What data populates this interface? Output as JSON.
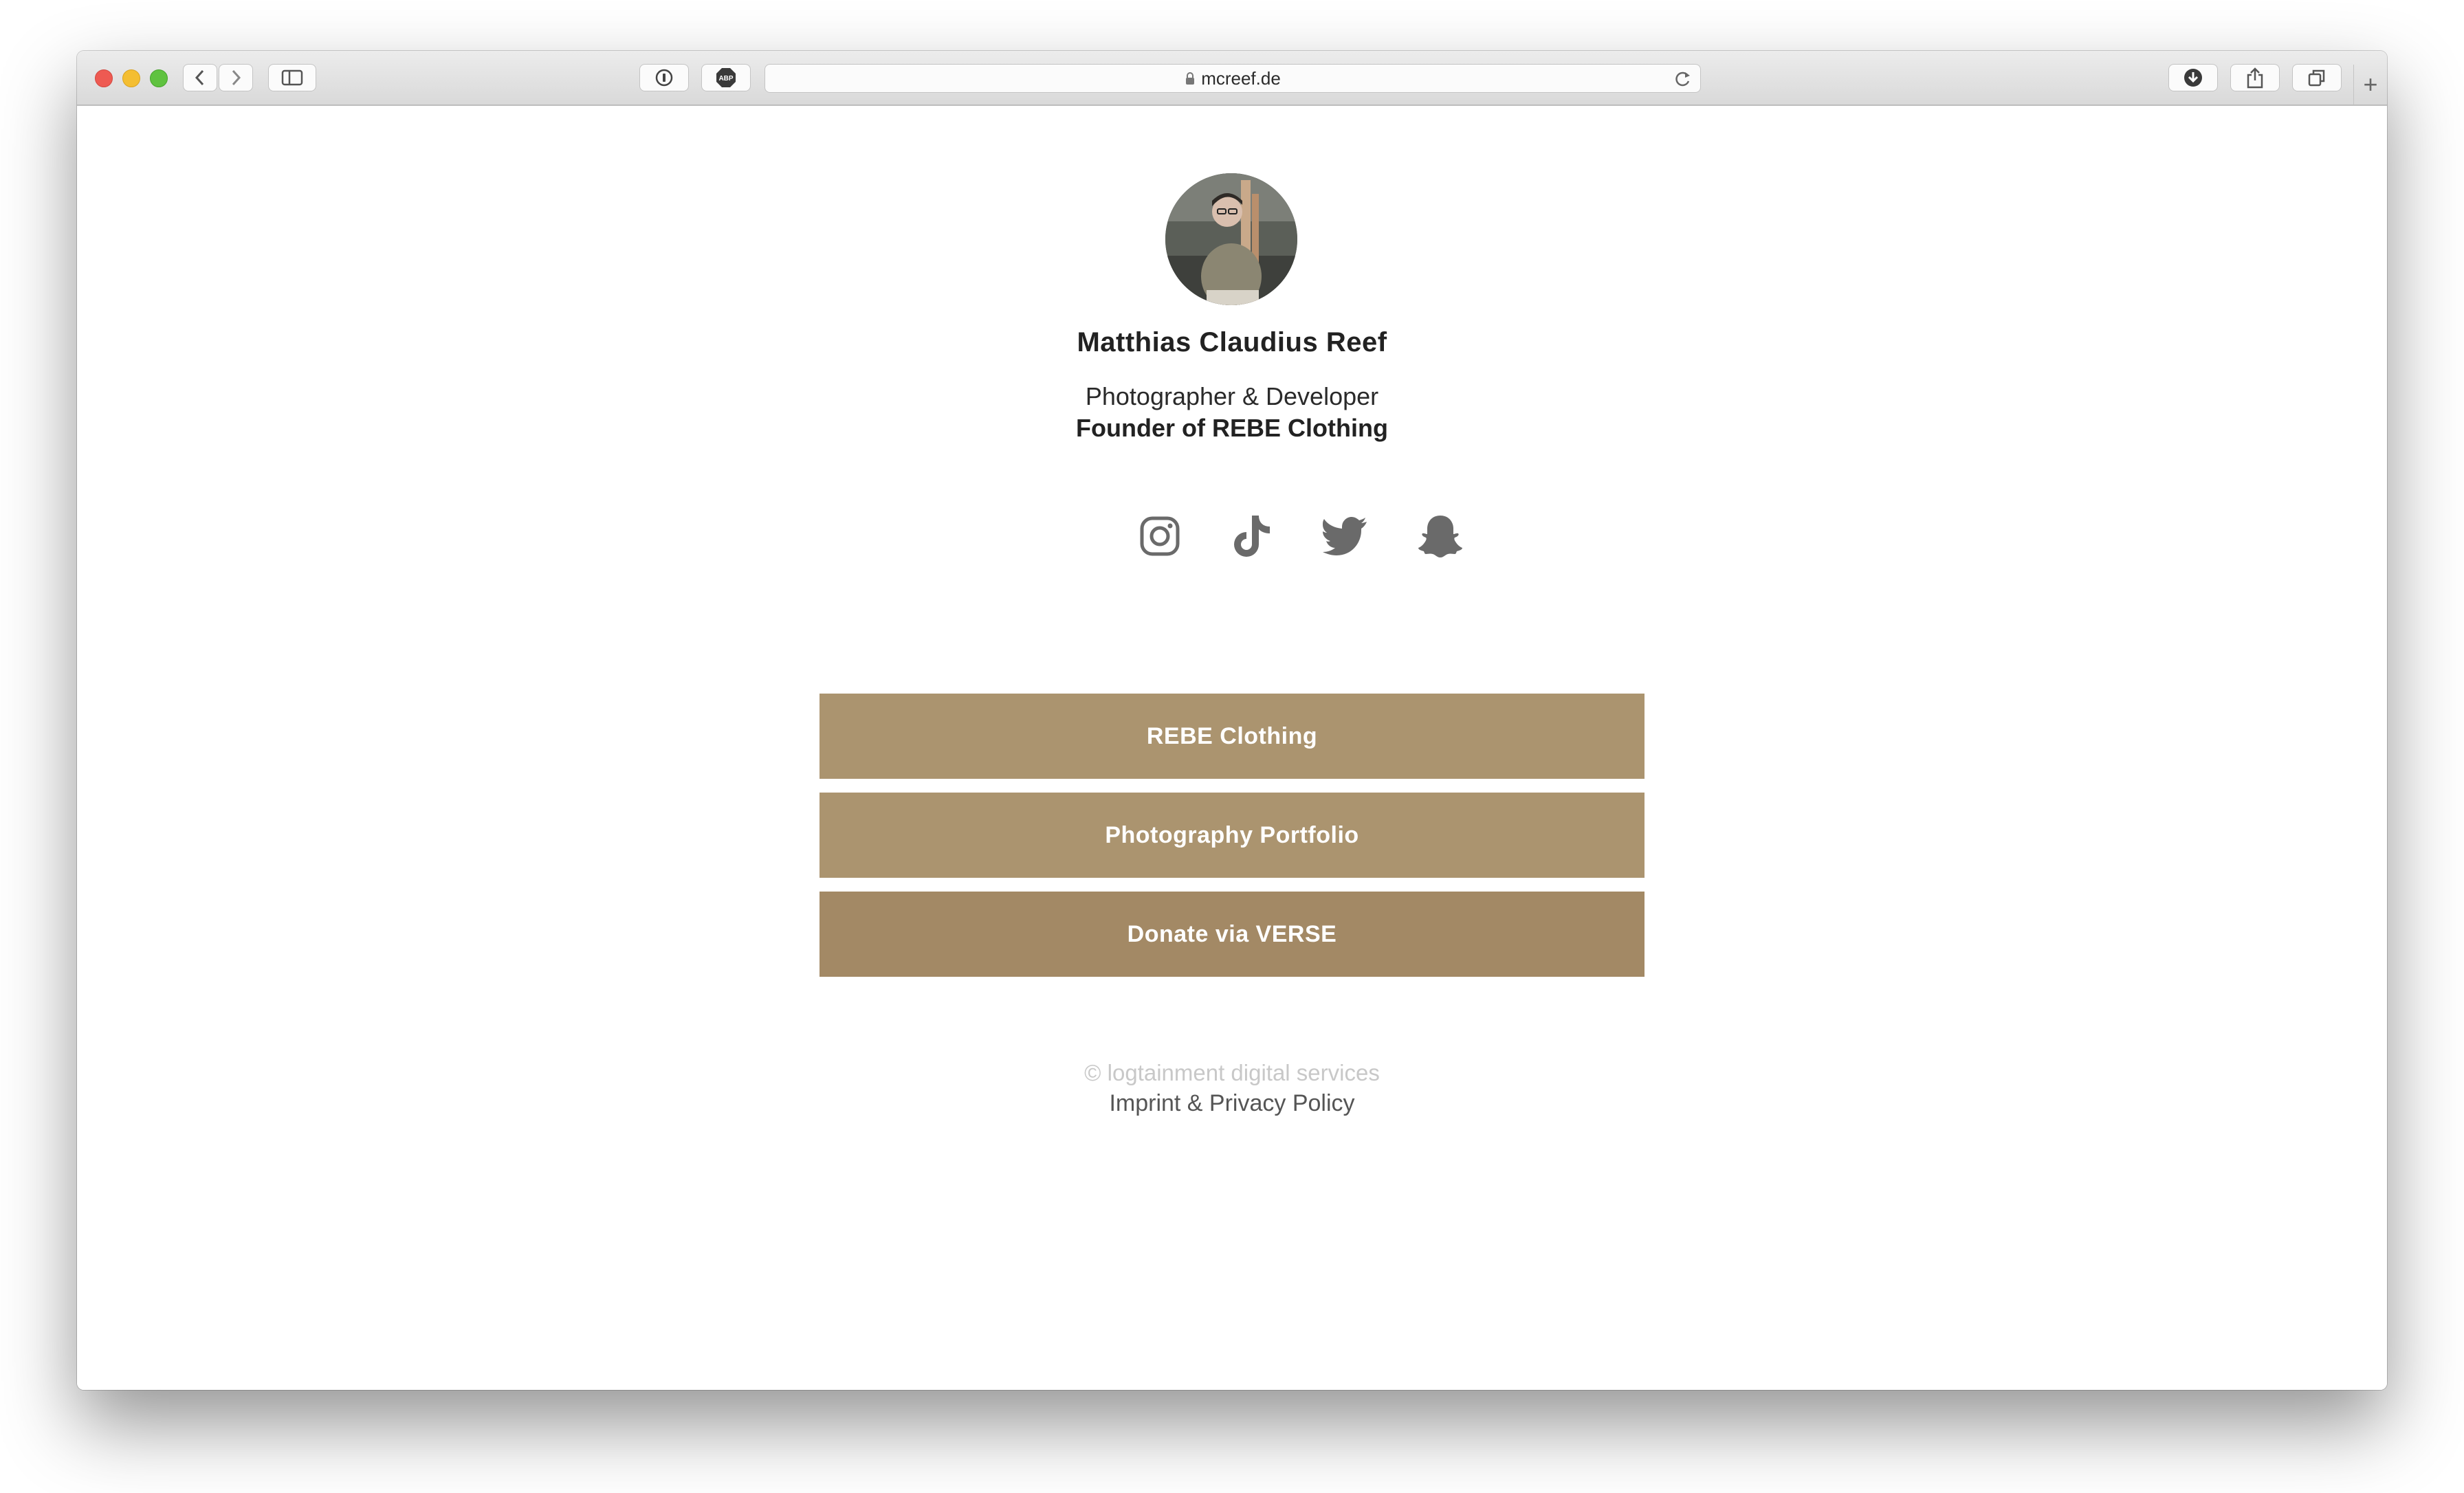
{
  "browser": {
    "url": "mcreef.de",
    "new_tab_symbol": "+",
    "icons": [
      "back-icon",
      "forward-icon",
      "sidebar-icon",
      "password-icon",
      "adblock-icon",
      "lock-icon",
      "reload-icon",
      "downloads-icon",
      "share-icon",
      "tabs-icon"
    ],
    "adblock_label": "ABP"
  },
  "profile": {
    "name": "Matthias Claudius Reef",
    "tagline": "Photographer & Developer",
    "founder_line": "Founder of REBE Clothing"
  },
  "socials": [
    "instagram-icon",
    "tiktok-icon",
    "twitter-icon",
    "snapchat-icon"
  ],
  "links": [
    {
      "label": "REBE Clothing",
      "color": "#ab946f"
    },
    {
      "label": "Photography Portfolio",
      "color": "#ab946f"
    },
    {
      "label": "Donate via VERSE",
      "color": "#a38965"
    }
  ],
  "footer": {
    "copyright": "© logtainment digital services",
    "legal": "Imprint & Privacy Policy"
  },
  "colors": {
    "button": "#ab946f",
    "icon": "#6a6a6a",
    "footer_muted": "#c8c8c8"
  }
}
